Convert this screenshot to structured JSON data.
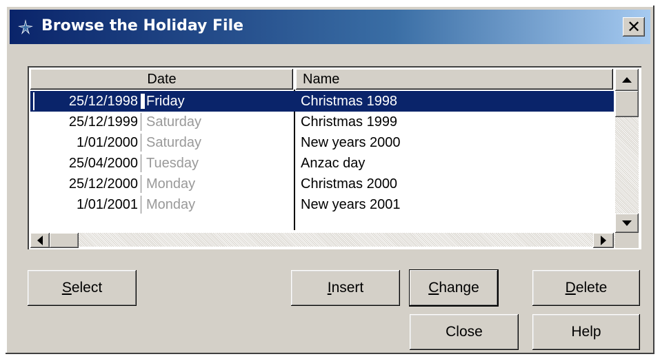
{
  "window": {
    "title": "Browse the Holiday File",
    "close_glyph": "✕"
  },
  "table": {
    "columns": [
      "Date",
      "Name"
    ],
    "rows": [
      {
        "date": "25/12/1998",
        "day": "Friday",
        "name": "Christmas 1998",
        "selected": true
      },
      {
        "date": "25/12/1999",
        "day": "Saturday",
        "name": "Christmas 1999",
        "selected": false
      },
      {
        "date": "1/01/2000",
        "day": "Saturday",
        "name": "New years 2000",
        "selected": false
      },
      {
        "date": "25/04/2000",
        "day": "Tuesday",
        "name": "Anzac day",
        "selected": false
      },
      {
        "date": "25/12/2000",
        "day": "Monday",
        "name": "Christmas 2000",
        "selected": false
      },
      {
        "date": "1/01/2001",
        "day": "Monday",
        "name": "New years 2001",
        "selected": false
      }
    ]
  },
  "buttons": {
    "select": {
      "accel": "S",
      "rest": "elect"
    },
    "insert": {
      "accel": "I",
      "rest": "nsert"
    },
    "change": {
      "accel": "C",
      "rest": "hange"
    },
    "delete": {
      "accel": "D",
      "rest": "elete"
    },
    "close": "Close",
    "help": "Help"
  },
  "colors": {
    "title_start": "#0a246a",
    "title_end": "#a6caf0",
    "selection": "#0a246a",
    "face": "#d4d0c8",
    "weekday_text": "#999999"
  },
  "icons": {
    "title": "app-star-icon",
    "scroll_up": "arrow-up-icon",
    "scroll_down": "arrow-down-icon",
    "scroll_left": "arrow-left-icon",
    "scroll_right": "arrow-right-icon"
  }
}
